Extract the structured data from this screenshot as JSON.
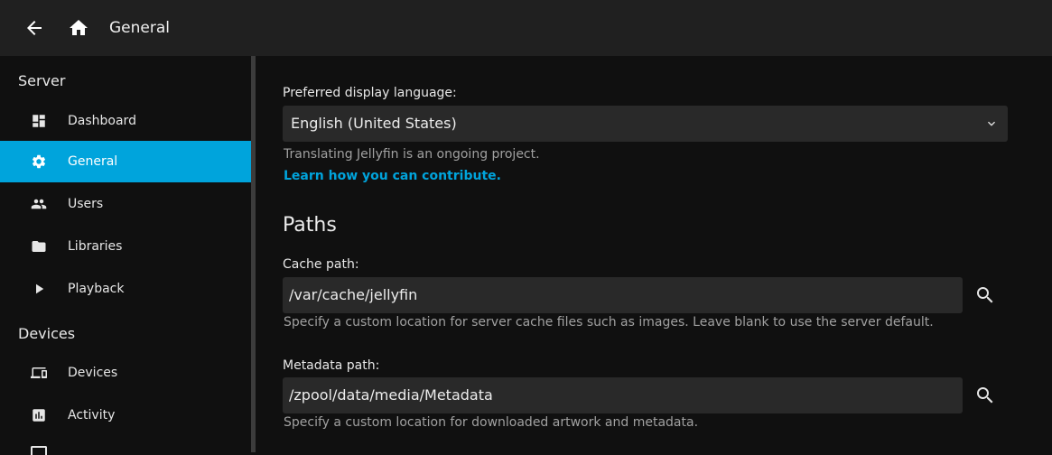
{
  "header": {
    "title": "General",
    "back_icon": "arrow-back-icon",
    "home_icon": "home-icon"
  },
  "sidebar": {
    "sections": [
      {
        "title": "Server",
        "items": [
          {
            "label": "Dashboard",
            "icon": "dashboard-icon"
          },
          {
            "label": "General",
            "icon": "gear-icon",
            "active": true
          },
          {
            "label": "Users",
            "icon": "people-icon"
          },
          {
            "label": "Libraries",
            "icon": "folder-icon"
          },
          {
            "label": "Playback",
            "icon": "play-icon"
          }
        ]
      },
      {
        "title": "Devices",
        "items": [
          {
            "label": "Devices",
            "icon": "devices-icon"
          },
          {
            "label": "Activity",
            "icon": "bar-chart-icon"
          }
        ]
      }
    ],
    "accent_color": "#00a4dc"
  },
  "main": {
    "language": {
      "label": "Preferred display language:",
      "value": "English (United States)",
      "help": "Translating Jellyfin is an ongoing project.",
      "link": "Learn how you can contribute."
    },
    "paths_heading": "Paths",
    "cache": {
      "label": "Cache path:",
      "value": "/var/cache/jellyfin",
      "help": "Specify a custom location for server cache files such as images. Leave blank to use the server default."
    },
    "metadata": {
      "label": "Metadata path:",
      "value": "/zpool/data/media/Metadata",
      "help": "Specify a custom location for downloaded artwork and metadata."
    }
  }
}
